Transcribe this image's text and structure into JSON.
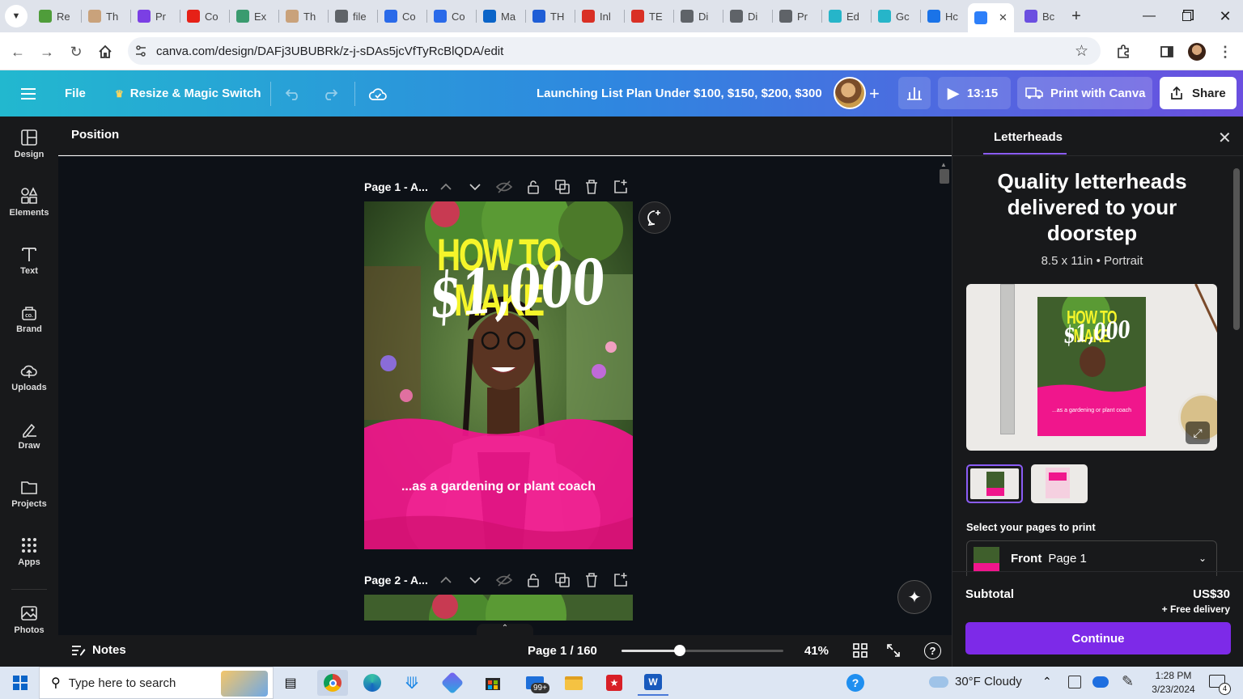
{
  "browser": {
    "tabs": [
      {
        "label": "Re",
        "color": "#4f9d3a"
      },
      {
        "label": "Th",
        "color": "#c9a27b"
      },
      {
        "label": "Pr",
        "color": "#7b3fe4"
      },
      {
        "label": "Co",
        "color": "#e62117"
      },
      {
        "label": "Ex",
        "color": "#3a9b6f"
      },
      {
        "label": "Th",
        "color": "#c9a27b"
      },
      {
        "label": "file",
        "color": "#5f6368"
      },
      {
        "label": "Co",
        "color": "#2a6ae9"
      },
      {
        "label": "Co",
        "color": "#2a6ae9"
      },
      {
        "label": "Ma",
        "color": "#0a64c8"
      },
      {
        "label": "TH",
        "color": "#1f5ed6"
      },
      {
        "label": "Inl",
        "color": "#d93025"
      },
      {
        "label": "TE",
        "color": "#d93025"
      },
      {
        "label": "Di",
        "color": "#5f6368"
      },
      {
        "label": "Di",
        "color": "#5f6368"
      },
      {
        "label": "Pr",
        "color": "#5f6368"
      },
      {
        "label": "Ed",
        "color": "#26b5c9"
      },
      {
        "label": "Gc",
        "color": "#26b5c9"
      },
      {
        "label": "Hc",
        "color": "#1a73e8"
      },
      {
        "label": "",
        "color": "#2d7ff9"
      },
      {
        "label": "Bc",
        "color": "#6b4fe0"
      }
    ],
    "url": "canva.com/design/DAFj3UBUBRk/z-j-sDAs5jcVfTyRcBlQDA/edit"
  },
  "header": {
    "file_label": "File",
    "resize_label": "Resize & Magic Switch",
    "design_title": "Launching List Plan Under $100, $150, $200, $300",
    "timer": "13:15",
    "print_label": "Print with Canva",
    "share_label": "Share"
  },
  "rail": [
    {
      "label": "Design",
      "icon": "layout-icon"
    },
    {
      "label": "Elements",
      "icon": "shapes-icon"
    },
    {
      "label": "Text",
      "icon": "text-icon"
    },
    {
      "label": "Brand",
      "icon": "brand-icon"
    },
    {
      "label": "Uploads",
      "icon": "cloud-upload-icon"
    },
    {
      "label": "Draw",
      "icon": "pen-icon"
    },
    {
      "label": "Projects",
      "icon": "folder-icon"
    },
    {
      "label": "Apps",
      "icon": "grid-icon"
    },
    {
      "label": "Photos",
      "icon": "image-icon"
    }
  ],
  "toolbar": {
    "position_label": "Position"
  },
  "pages": [
    {
      "label": "Page 1 - A..."
    },
    {
      "label": "Page 2 - A..."
    }
  ],
  "design": {
    "headline": "HOW TO MAKE",
    "amount": "$1,000",
    "subline": "...as a gardening or plant coach"
  },
  "bottom": {
    "notes_label": "Notes",
    "page_indicator": "Page 1 / 160",
    "zoom": "41%",
    "zoom_value": 0.36
  },
  "panel": {
    "tab_label": "Letterheads",
    "heading_1": "Quality letterheads",
    "heading_2": "delivered to your",
    "heading_3": "doorstep",
    "spec": "8.5 x 11in • Portrait",
    "select_label": "Select your pages to print",
    "front_label": "Front",
    "front_page": "Page 1",
    "subtotal_label": "Subtotal",
    "price": "US$30",
    "delivery": "+ Free delivery",
    "continue_label": "Continue",
    "thumb_caption": "...as a gardening or plant coach"
  },
  "taskbar": {
    "search_placeholder": "Type here to search",
    "badge": "99+",
    "weather": "30°F  Cloudy",
    "time": "1:28 PM",
    "date": "3/23/2024",
    "notif_count": "4"
  },
  "colors": {
    "accent_purple": "#7d2ae8",
    "pink": "#f0168c",
    "yellow": "#f5f52a"
  }
}
